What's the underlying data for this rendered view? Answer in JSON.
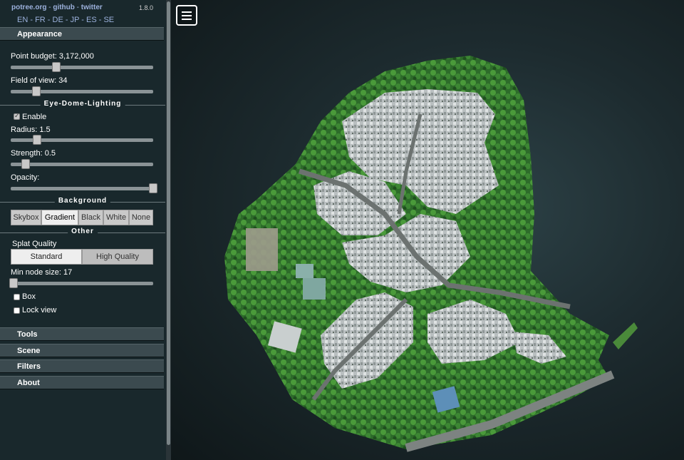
{
  "header": {
    "links": [
      "potree.org",
      "github",
      "twitter"
    ],
    "version": "1.8.0",
    "languages": [
      "EN",
      "FR",
      "DE",
      "JP",
      "ES",
      "SE"
    ]
  },
  "appearance": {
    "title": "Appearance",
    "point_budget_label": "Point budget: 3,172,000",
    "point_budget_value": 3172000,
    "fov_label": "Field of view: 34",
    "fov_value": 34,
    "edl_heading": "Eye-Dome-Lighting",
    "edl_enable_label": "Enable",
    "edl_enabled": true,
    "radius_label": "Radius: 1.5",
    "strength_label": "Strength: 0.5",
    "opacity_label": "Opacity:",
    "background_heading": "Background",
    "background_options": [
      "Skybox",
      "Gradient",
      "Black",
      "White",
      "None"
    ],
    "background_selected": "Gradient",
    "other_heading": "Other",
    "splat_quality_label": "Splat Quality",
    "splat_options": [
      "Standard",
      "High Quality"
    ],
    "splat_selected": "Standard",
    "min_node_label": "Min node size: 17",
    "box_label": "Box",
    "lock_view_label": "Lock view"
  },
  "sections": [
    "Tools",
    "Scene",
    "Filters",
    "About"
  ],
  "icons": {
    "menu": "hamburger-menu-icon",
    "check": "checkmark-icon"
  }
}
